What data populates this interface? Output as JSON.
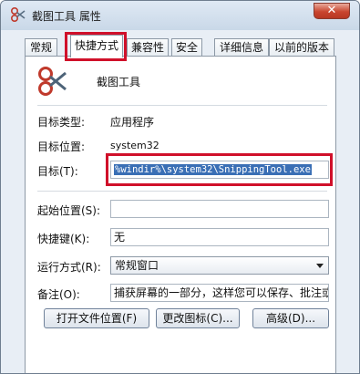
{
  "window": {
    "title": "截图工具 属性",
    "close_glyph": "✕"
  },
  "tabs": [
    {
      "label": "常规"
    },
    {
      "label": "快捷方式",
      "active": true
    },
    {
      "label": "兼容性"
    },
    {
      "label": "安全"
    },
    {
      "label": "详细信息"
    },
    {
      "label": "以前的版本"
    }
  ],
  "app": {
    "name": "截图工具",
    "icon": "scissors-icon"
  },
  "fields": {
    "target_type_label": "目标类型:",
    "target_type_value": "应用程序",
    "target_location_label": "目标位置:",
    "target_location_value": "system32",
    "target_label": "目标(T):",
    "target_value": "%windir%\\system32\\SnippingTool.exe",
    "start_in_label": "起始位置(S):",
    "start_in_value": "",
    "shortcut_key_label": "快捷键(K):",
    "shortcut_key_value": "无",
    "run_label": "运行方式(R):",
    "run_value": "常规窗口",
    "comment_label": "备注(O):",
    "comment_value": "捕获屏幕的一部分，这样您可以保存、批注或"
  },
  "buttons": {
    "open_location": "打开文件位置(F)",
    "change_icon": "更改图标(C)...",
    "advanced": "高级(D)..."
  },
  "colors": {
    "highlight_red": "#d0102a",
    "selection_blue": "#3a6fb5"
  }
}
